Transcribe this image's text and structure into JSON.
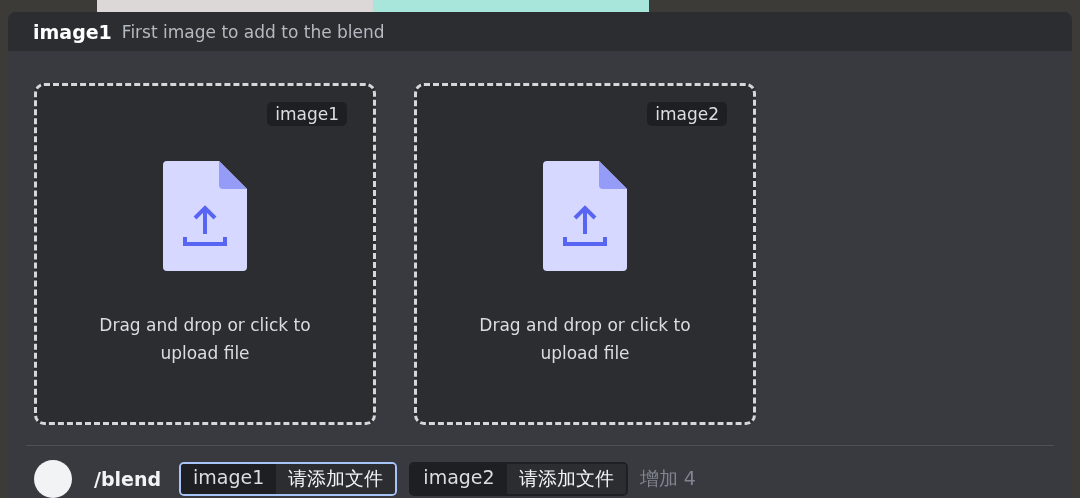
{
  "header": {
    "option": "image1",
    "description": "First image to add to the blend"
  },
  "dropzones": [
    {
      "tag": "image1",
      "prompt": "Drag and drop or click to upload file"
    },
    {
      "tag": "image2",
      "prompt": "Drag and drop or click to upload file"
    }
  ],
  "command_bar": {
    "command": "/blend",
    "options": [
      {
        "name": "image1",
        "value": "请添加文件",
        "selected": true
      },
      {
        "name": "image2",
        "value": "请添加文件",
        "selected": false
      }
    ],
    "more": "增加 4"
  }
}
